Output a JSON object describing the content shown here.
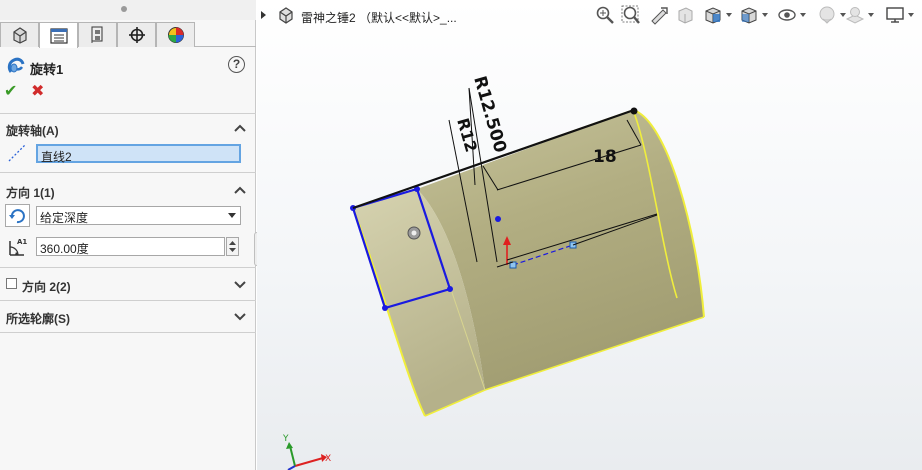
{
  "property_manager": {
    "tabs": [
      {
        "name": "feature-manager",
        "icon": "feature-tree-icon"
      },
      {
        "name": "property-manager",
        "icon": "property-list-icon"
      },
      {
        "name": "configuration-manager",
        "icon": "configuration-icon"
      },
      {
        "name": "dimxpert-manager",
        "icon": "crosshair-icon"
      },
      {
        "name": "display-manager",
        "icon": "color-wheel-icon"
      }
    ],
    "feature_title": "旋转1",
    "help": "?",
    "ok": "✔",
    "cancel": "✖",
    "axis_group": {
      "title": "旋转轴(A)",
      "axis_value": "直线2"
    },
    "direction1_group": {
      "title": "方向 1(1)",
      "end_condition": "给定深度",
      "angle_value": "360.00度",
      "angle_label": "A1"
    },
    "direction2_group": {
      "title": "方向 2(2)",
      "checked": false
    },
    "selected_contours_group": {
      "title": "所选轮廓(S)"
    }
  },
  "graphics": {
    "document_title": "雷神之锤2 （默认<<默认>_...",
    "toolbar_icons": [
      "zoom-to-fit-icon",
      "zoom-to-area-icon",
      "previous-view-icon",
      "section-view-icon",
      "view-orientation-icon",
      "display-style-icon",
      "hide-show-items-icon",
      "edit-appearance-icon",
      "apply-scene-icon",
      "view-settings-icon"
    ],
    "dimensions": {
      "r12_5": "R12.500",
      "r12": "R12",
      "length": "18"
    },
    "triad": {
      "x_label": "X",
      "y_label": "Y"
    },
    "colors": {
      "body": "#b8b48a",
      "edge_highlight": "#f0ee3c",
      "sketch": "#1a1ae0",
      "dimension": "#111111"
    }
  }
}
